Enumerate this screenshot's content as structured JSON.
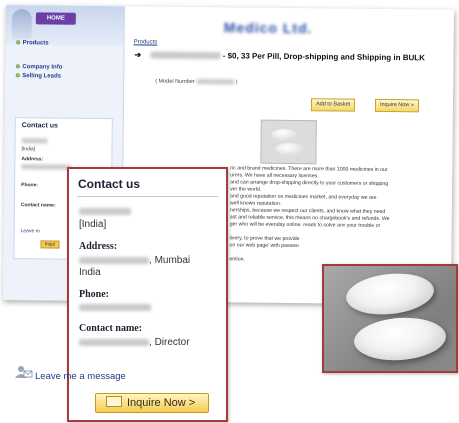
{
  "page": {
    "home_label": "HOME",
    "sidebar_links": [
      "Products",
      "Company Info",
      "Selling Leads"
    ],
    "sidebar_contact": {
      "title": "Contact us",
      "country": "[India]",
      "address_label": "Address:",
      "phone_label": "Phone:",
      "contact_label": "Contact name:",
      "message_link": "Leave m",
      "inquire_label": "Inqui"
    },
    "breadcrumb": "Products",
    "product_title": "- $0, 33 Per Pill, Drop-shipping and Shipping in BULK",
    "model_label": "( Model Number",
    "add_to_basket": "Add to Basket",
    "inquire_now": "Inquire Now »",
    "description": [
      "ric and brand medicines. There are more than 1000 medicines in our",
      "urers. We have all necessary licenses.",
      "and can arrange drop-shipping directly to your customers or shipping",
      "ver the world.",
      "and good reputation on medicines market, and everyday we are",
      "well known reputation.",
      "nerships, because we respect our clients, and know what they need",
      "ast and reliable service, this means no chargebook's and refunds. We",
      "ger who will be evenday online. reads to solve anv your trouble or",
      "",
      "livery, to prove that we provide",
      "on our web page' with passwo",
      "",
      "ention."
    ]
  },
  "contact": {
    "title": "Contact us",
    "country": "[India]",
    "address_label": "Address:",
    "address_city": "Mumbai",
    "address_country": "India",
    "phone_label": "Phone:",
    "contact_label": "Contact name:",
    "contact_role": "Director",
    "message_link": "Leave me a message",
    "inquire_button": "Inquire Now >"
  },
  "colors": {
    "callout_border": "#a53a3a",
    "link": "#1e3f86",
    "button_gold": "#f4cc52"
  },
  "icons": [
    "logo-figure-icon",
    "envelope-person-icon",
    "mail-icon",
    "arrow-icon"
  ]
}
